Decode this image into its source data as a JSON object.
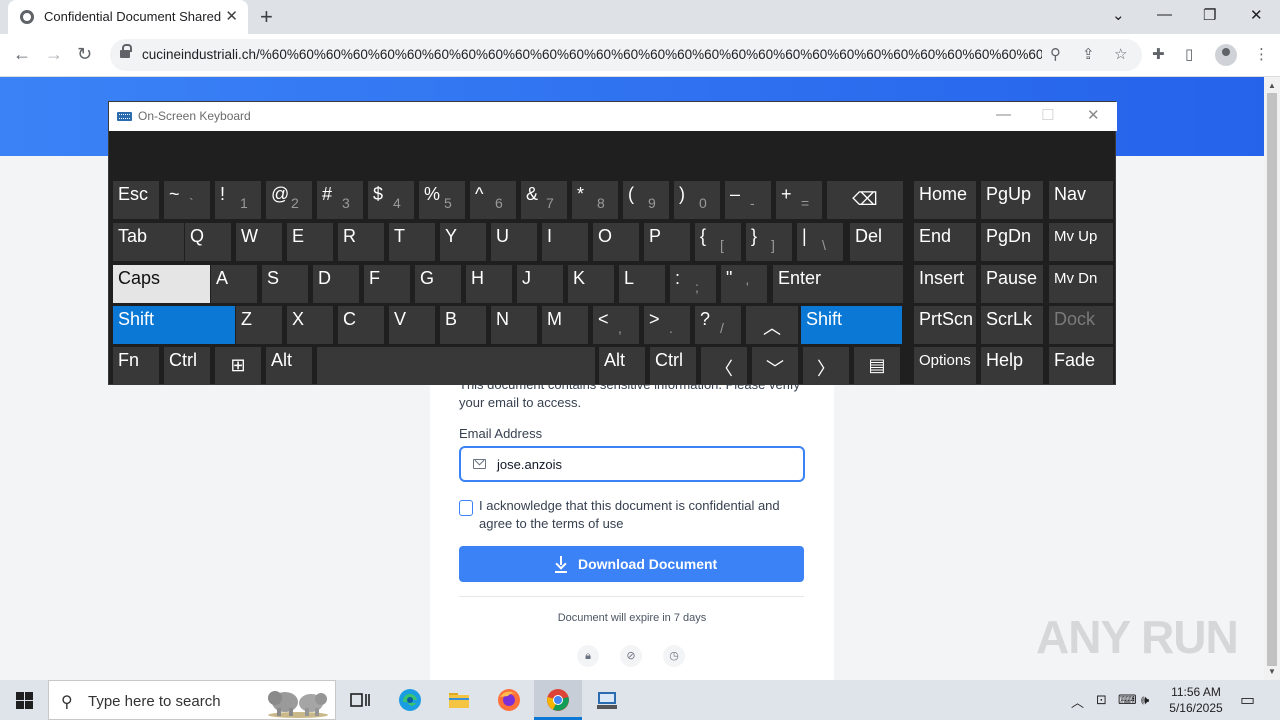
{
  "browser": {
    "tab_title": "Confidential Document Shared",
    "url": "cucineindustriali.ch/%60%60%60%60%60%60%60%60%60%60%60%60%60%60%60%60%60%60%60%60%60%60%60%60%60%60%60%60%60%60%60%...",
    "window_controls": {
      "menu": "⌄",
      "minimize": "—",
      "restore": "❐",
      "close": "✕"
    }
  },
  "page": {
    "description": "This document contains sensitive information. Please verify your email to access.",
    "email_label": "Email Address",
    "email_value": "jose.anzois",
    "acknowledge_text": "I acknowledge that this document is confidential and agree to the terms of use",
    "download_label": "Download Document",
    "expire_text": "Document will expire in 7 days",
    "accent_color": "#3b82f6",
    "footer_icons": [
      "lock-icon",
      "eye-off-icon",
      "clock-icon"
    ]
  },
  "watermark": "ANY RUN",
  "osk": {
    "title": "On-Screen Keyboard",
    "controls": {
      "minimize": "—",
      "maximize": "☐",
      "close": "✕"
    },
    "active_color": "#0a78d4",
    "row1": [
      {
        "m": "Esc"
      },
      {
        "m": "~",
        "s": "`"
      },
      {
        "m": "!",
        "s": "1"
      },
      {
        "m": "@",
        "s": "2"
      },
      {
        "m": "#",
        "s": "3"
      },
      {
        "m": "$",
        "s": "4"
      },
      {
        "m": "%",
        "s": "5"
      },
      {
        "m": "^",
        "s": "6"
      },
      {
        "m": "&",
        "s": "7"
      },
      {
        "m": "*",
        "s": "8"
      },
      {
        "m": "(",
        "s": "9"
      },
      {
        "m": ")",
        "s": "0"
      },
      {
        "m": "–",
        "s": "-"
      },
      {
        "m": "+",
        "s": "="
      },
      {
        "m": "⌫"
      },
      {
        "m": "Home"
      },
      {
        "m": "PgUp"
      },
      {
        "m": "Nav"
      }
    ],
    "row2": [
      {
        "m": "Tab"
      },
      {
        "m": "Q"
      },
      {
        "m": "W"
      },
      {
        "m": "E"
      },
      {
        "m": "R"
      },
      {
        "m": "T"
      },
      {
        "m": "Y"
      },
      {
        "m": "U"
      },
      {
        "m": "I"
      },
      {
        "m": "O"
      },
      {
        "m": "P"
      },
      {
        "m": "{",
        "s": "["
      },
      {
        "m": "}",
        "s": "]"
      },
      {
        "m": "|",
        "s": "\\"
      },
      {
        "m": "Del"
      },
      {
        "m": "End"
      },
      {
        "m": "PgDn"
      },
      {
        "m": "Mv Up"
      }
    ],
    "row3": [
      {
        "m": "Caps"
      },
      {
        "m": "A"
      },
      {
        "m": "S"
      },
      {
        "m": "D"
      },
      {
        "m": "F"
      },
      {
        "m": "G"
      },
      {
        "m": "H"
      },
      {
        "m": "J"
      },
      {
        "m": "K"
      },
      {
        "m": "L"
      },
      {
        "m": ":",
        "s": ";"
      },
      {
        "m": "\"",
        "s": "'"
      },
      {
        "m": "Enter"
      },
      {
        "m": "Insert"
      },
      {
        "m": "Pause"
      },
      {
        "m": "Mv Dn"
      }
    ],
    "row4": [
      {
        "m": "Shift"
      },
      {
        "m": "Z"
      },
      {
        "m": "X"
      },
      {
        "m": "C"
      },
      {
        "m": "V"
      },
      {
        "m": "B"
      },
      {
        "m": "N"
      },
      {
        "m": "M"
      },
      {
        "m": "<",
        "s": ","
      },
      {
        "m": ">",
        "s": "."
      },
      {
        "m": "?",
        "s": "/"
      },
      {
        "m": "︿"
      },
      {
        "m": "Shift"
      },
      {
        "m": "PrtScn"
      },
      {
        "m": "ScrLk"
      },
      {
        "m": "Dock"
      }
    ],
    "row5": [
      {
        "m": "Fn"
      },
      {
        "m": "Ctrl"
      },
      {
        "m": "⊞"
      },
      {
        "m": "Alt"
      },
      {
        "m": ""
      },
      {
        "m": "Alt"
      },
      {
        "m": "Ctrl"
      },
      {
        "m": "〈"
      },
      {
        "m": "﹀"
      },
      {
        "m": "〉"
      },
      {
        "m": "▤"
      },
      {
        "m": "Options"
      },
      {
        "m": "Help"
      },
      {
        "m": "Fade"
      }
    ]
  },
  "taskbar": {
    "search_placeholder": "Type here to search",
    "time": "11:56 AM",
    "date": "5/16/2025"
  }
}
